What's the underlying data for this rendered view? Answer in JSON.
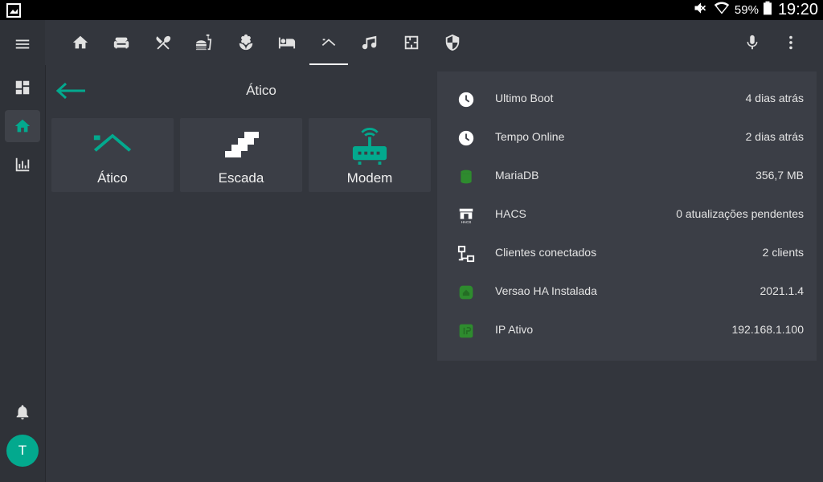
{
  "status": {
    "battery": "59%",
    "time": "19:20"
  },
  "sidebar": {
    "avatar_initial": "T"
  },
  "toolbar": {
    "tabs": [
      "home-icon",
      "sofa-icon",
      "silverware-icon",
      "food-drink-icon",
      "flower-icon",
      "bed-icon",
      "roof-icon",
      "music-icon",
      "floor-plan-icon",
      "shield-icon"
    ],
    "active_tab": "roof-icon"
  },
  "subview": {
    "title": "Ático"
  },
  "tiles": [
    {
      "label": "Ático",
      "icon": "roof-icon"
    },
    {
      "label": "Escada",
      "icon": "stairs-icon"
    },
    {
      "label": "Modem",
      "icon": "router-wireless-icon"
    }
  ],
  "info_rows": [
    {
      "label": "Ultimo Boot",
      "value": "4 dias atrás",
      "icon": "clock-icon"
    },
    {
      "label": "Tempo Online",
      "value": "2 dias atrás",
      "icon": "clock-icon"
    },
    {
      "label": "MariaDB",
      "value": "356,7 MB",
      "icon": "database-icon"
    },
    {
      "label": "HACS",
      "value": "0 atualizações pendentes",
      "icon": "hacs-icon"
    },
    {
      "label": "Clientes conectados",
      "value": "2 clients",
      "icon": "lan-icon"
    },
    {
      "label": "Versao HA Instalada",
      "value": "2021.1.4",
      "icon": "home-assistant-icon"
    },
    {
      "label": "IP Ativo",
      "value": "192.168.1.100",
      "icon": "ip-icon"
    }
  ],
  "colors": {
    "accent": "#03a98e",
    "green_icon": "#2e8b2e",
    "background": "#33363d",
    "card": "#3b3e46"
  }
}
